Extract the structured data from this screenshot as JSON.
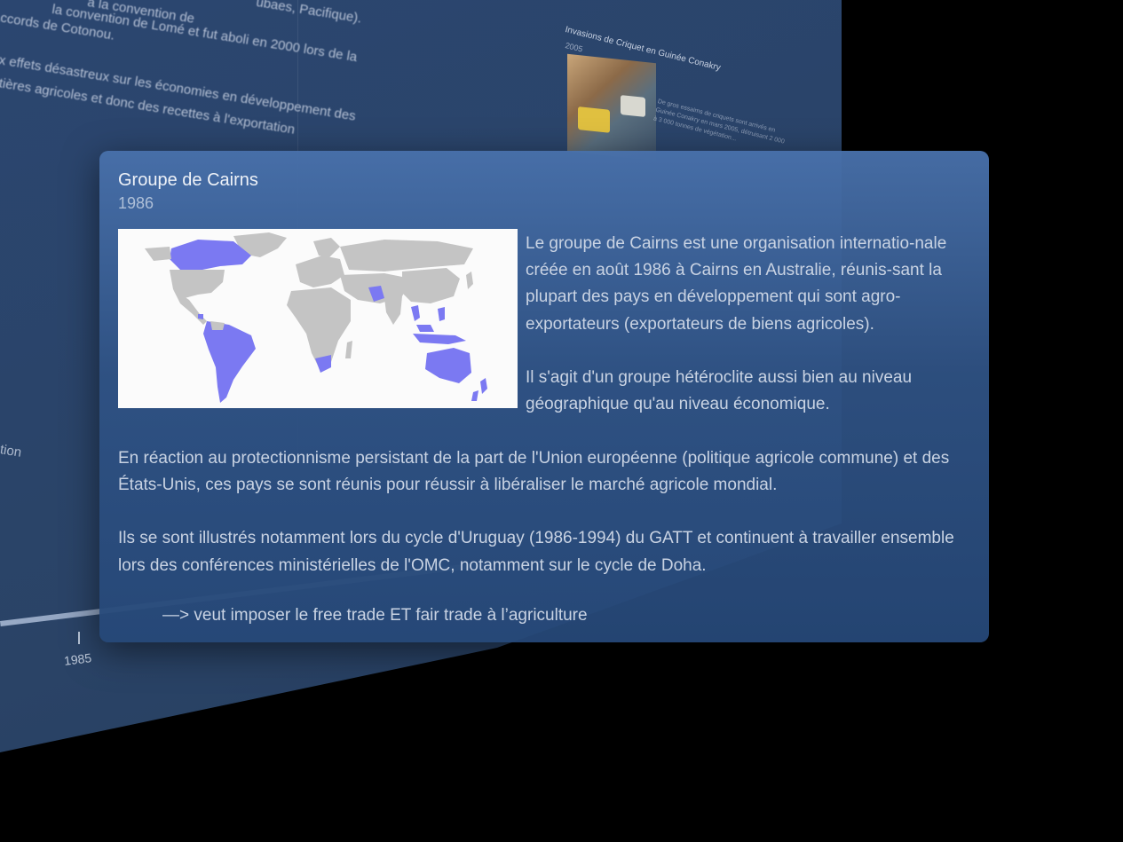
{
  "background": {
    "lines": [
      "la convention de Lomé et fut aboli en 2000 lors de la",
      "Accords de Cotonou.",
      "ux effets désastreux sur les économies en développement des",
      "atières agricoles et donc des recettes à l'exportation"
    ],
    "top_fragment": "à la convention de",
    "top_fragment_2": "ubaes, Pacifique).",
    "side_label": "tion",
    "timeline_tick": "1985",
    "event_card": {
      "title": "Invasions de Criquet en Guinée Conakry",
      "year": "2005",
      "snippet": "De gros essaims de criquets sont arrivés en Guinée Conakry en mars 2005, détruisant 2 000 à 3 000 tonnes de végétation..."
    }
  },
  "popup": {
    "title": "Groupe de Cairns",
    "year": "1986",
    "intro_paragraphs": [
      "Le groupe de Cairns est une organisation internatio-nale créée en août 1986 à Cairns en Australie, réunis-sant la plupart des pays en développement qui sont agro-exportateurs (exportateurs de biens agricoles).",
      "Il s'agit d'un groupe hétéroclite aussi bien au niveau géographique qu'au niveau économique."
    ],
    "body_paragraphs": [
      "En réaction au protectionnisme persistant de la part de l'Union européenne (politique agricole commune) et des États-Unis, ces pays se sont réunis pour réussir à libéraliser le marché agricole mondial.",
      "Ils se sont illustrés notamment lors du cycle d'Uruguay (1986-1994) du GATT et continuent à travailler ensemble lors des conférences ministérielles de l'OMC, notamment sur le cycle de Doha."
    ],
    "note": "—> veut imposer le free trade ET fair trade à l’agriculture"
  },
  "colors": {
    "member_country": "#7b79f2",
    "other_country": "#c4c4c4",
    "map_background": "#fbfbfb"
  }
}
